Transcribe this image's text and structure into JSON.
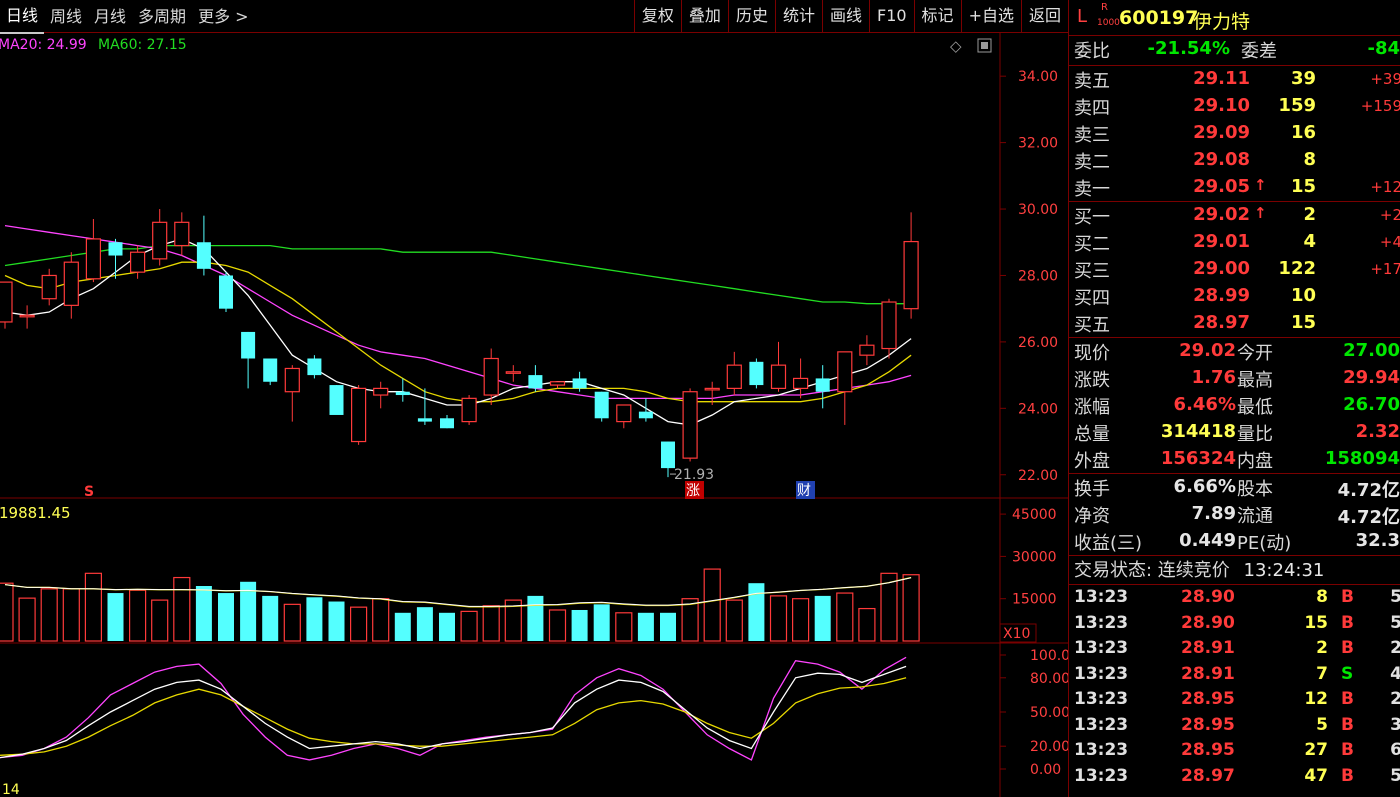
{
  "toolbar": {
    "periods": [
      "日线",
      "周线",
      "月线",
      "多周期",
      "更多 >"
    ],
    "buttons": [
      "复权",
      "叠加",
      "历史",
      "统计",
      "画线",
      "F10",
      "标记",
      "+自选",
      "返回"
    ]
  },
  "ma_legend": {
    "ma20": "MA20: 24.99",
    "ma60": "MA60: 27.15"
  },
  "colors": {
    "up": "#ff3a3a",
    "down": "#54ffff",
    "ma5": "#ffffff",
    "ma10": "#e6d800",
    "ma20": "#ff44ff",
    "ma60": "#22dd22",
    "grid": "#7a0000",
    "axis_text": "#ff4040"
  },
  "price_axis": {
    "ticks": [
      "34.00",
      "32.00",
      "30.00",
      "28.00",
      "26.00",
      "24.00",
      "22.00"
    ],
    "min": 21.3,
    "max": 35.3
  },
  "low_label": "21.93",
  "markers": {
    "s": "S",
    "zhang": "涨",
    "cai": "财"
  },
  "vol_axis": {
    "ticks": [
      "45000",
      "30000",
      "15000"
    ],
    "unit": "X10",
    "max": 50000,
    "label": "19881.45"
  },
  "kdj_axis": {
    "ticks": [
      "100.00",
      "80.00",
      "50.00",
      "20.00",
      "0.00"
    ],
    "label": "14"
  },
  "chart_data": {
    "type": "candlestick",
    "candles": [
      {
        "o": 26.6,
        "h": 27.5,
        "l": 26.4,
        "c": 27.8
      },
      {
        "o": 26.8,
        "h": 27.1,
        "l": 26.4,
        "c": 26.8
      },
      {
        "o": 27.3,
        "h": 28.2,
        "l": 27.1,
        "c": 28.0
      },
      {
        "o": 27.1,
        "h": 28.7,
        "l": 26.7,
        "c": 28.4
      },
      {
        "o": 27.9,
        "h": 29.7,
        "l": 27.8,
        "c": 29.1
      },
      {
        "o": 29.0,
        "h": 29.1,
        "l": 27.9,
        "c": 28.6
      },
      {
        "o": 28.1,
        "h": 28.9,
        "l": 27.9,
        "c": 28.7
      },
      {
        "o": 28.5,
        "h": 30.0,
        "l": 28.3,
        "c": 29.6
      },
      {
        "o": 28.9,
        "h": 29.9,
        "l": 28.6,
        "c": 29.6
      },
      {
        "o": 29.0,
        "h": 29.8,
        "l": 28.0,
        "c": 28.2
      },
      {
        "o": 28.0,
        "h": 28.1,
        "l": 26.9,
        "c": 27.0
      },
      {
        "o": 26.3,
        "h": 26.3,
        "l": 24.6,
        "c": 25.5
      },
      {
        "o": 25.5,
        "h": 25.5,
        "l": 24.7,
        "c": 24.8
      },
      {
        "o": 24.5,
        "h": 25.3,
        "l": 23.6,
        "c": 25.2
      },
      {
        "o": 25.5,
        "h": 25.6,
        "l": 24.9,
        "c": 25.0
      },
      {
        "o": 24.7,
        "h": 24.7,
        "l": 23.9,
        "c": 23.8
      },
      {
        "o": 23.0,
        "h": 24.7,
        "l": 22.9,
        "c": 24.6
      },
      {
        "o": 24.4,
        "h": 24.8,
        "l": 24.0,
        "c": 24.6
      },
      {
        "o": 24.5,
        "h": 24.9,
        "l": 24.2,
        "c": 24.4
      },
      {
        "o": 23.7,
        "h": 24.6,
        "l": 23.5,
        "c": 23.6
      },
      {
        "o": 23.7,
        "h": 23.8,
        "l": 23.4,
        "c": 23.4
      },
      {
        "o": 23.6,
        "h": 24.4,
        "l": 23.5,
        "c": 24.3
      },
      {
        "o": 24.4,
        "h": 25.8,
        "l": 24.1,
        "c": 25.5
      },
      {
        "o": 25.1,
        "h": 25.3,
        "l": 24.8,
        "c": 25.1
      },
      {
        "o": 25.0,
        "h": 25.3,
        "l": 24.5,
        "c": 24.6
      },
      {
        "o": 24.7,
        "h": 24.8,
        "l": 24.6,
        "c": 24.8
      },
      {
        "o": 24.9,
        "h": 25.1,
        "l": 24.5,
        "c": 24.6
      },
      {
        "o": 24.5,
        "h": 24.5,
        "l": 23.6,
        "c": 23.7
      },
      {
        "o": 23.6,
        "h": 24.1,
        "l": 23.4,
        "c": 24.1
      },
      {
        "o": 23.9,
        "h": 24.3,
        "l": 23.6,
        "c": 23.7
      },
      {
        "o": 23.0,
        "h": 23.0,
        "l": 21.93,
        "c": 22.2
      },
      {
        "o": 22.5,
        "h": 24.6,
        "l": 22.4,
        "c": 24.5
      },
      {
        "o": 24.6,
        "h": 24.8,
        "l": 24.1,
        "c": 24.6
      },
      {
        "o": 24.6,
        "h": 25.7,
        "l": 24.4,
        "c": 25.3
      },
      {
        "o": 25.4,
        "h": 25.5,
        "l": 24.6,
        "c": 24.7
      },
      {
        "o": 24.6,
        "h": 26.0,
        "l": 24.5,
        "c": 25.3
      },
      {
        "o": 24.6,
        "h": 25.5,
        "l": 24.3,
        "c": 24.9
      },
      {
        "o": 24.9,
        "h": 25.3,
        "l": 24.0,
        "c": 24.5
      },
      {
        "o": 24.5,
        "h": 25.7,
        "l": 23.5,
        "c": 25.7
      },
      {
        "o": 25.6,
        "h": 26.2,
        "l": 25.3,
        "c": 25.9
      },
      {
        "o": 25.8,
        "h": 27.3,
        "l": 25.5,
        "c": 27.2
      },
      {
        "o": 27.0,
        "h": 29.9,
        "l": 26.7,
        "c": 29.02
      }
    ],
    "ma5": [
      26.9,
      26.8,
      26.9,
      27.3,
      27.6,
      28.1,
      28.6,
      28.9,
      29.1,
      28.8,
      28.1,
      27.4,
      26.5,
      25.6,
      25.2,
      24.8,
      24.6,
      24.5,
      24.5,
      24.3,
      24.1,
      24.1,
      24.3,
      24.6,
      24.7,
      24.8,
      24.8,
      24.6,
      24.4,
      24.0,
      23.6,
      23.5,
      23.8,
      24.2,
      24.3,
      24.4,
      24.6,
      24.8,
      25.0,
      25.2,
      25.6,
      26.1
    ],
    "ma10": [
      28.0,
      27.7,
      27.6,
      27.8,
      27.9,
      28.0,
      28.1,
      28.2,
      28.4,
      28.4,
      28.3,
      28.1,
      27.7,
      27.3,
      26.8,
      26.3,
      25.8,
      25.3,
      24.9,
      24.5,
      24.3,
      24.2,
      24.2,
      24.3,
      24.5,
      24.6,
      24.6,
      24.6,
      24.6,
      24.5,
      24.3,
      24.2,
      24.2,
      24.2,
      24.2,
      24.2,
      24.2,
      24.3,
      24.5,
      24.7,
      25.1,
      25.6
    ],
    "ma20": [
      29.5,
      29.4,
      29.3,
      29.2,
      29.1,
      29.0,
      28.9,
      28.8,
      28.6,
      28.3,
      28.0,
      27.6,
      27.2,
      26.8,
      26.5,
      26.2,
      25.9,
      25.7,
      25.6,
      25.5,
      25.3,
      25.1,
      24.9,
      24.7,
      24.6,
      24.5,
      24.4,
      24.3,
      24.3,
      24.3,
      24.3,
      24.3,
      24.3,
      24.4,
      24.4,
      24.4,
      24.4,
      24.5,
      24.6,
      24.7,
      24.8,
      24.99
    ],
    "ma60": [
      28.3,
      28.4,
      28.5,
      28.6,
      28.7,
      28.8,
      28.8,
      28.9,
      28.9,
      28.9,
      28.9,
      28.9,
      28.9,
      28.8,
      28.8,
      28.8,
      28.8,
      28.8,
      28.7,
      28.7,
      28.7,
      28.7,
      28.7,
      28.6,
      28.5,
      28.4,
      28.3,
      28.2,
      28.1,
      28.0,
      27.9,
      27.8,
      27.7,
      27.6,
      27.5,
      27.4,
      27.3,
      27.2,
      27.2,
      27.15,
      27.15,
      27.15
    ],
    "volume": [
      20500,
      15200,
      18500,
      18500,
      24000,
      17000,
      18000,
      14500,
      22500,
      19500,
      17000,
      21000,
      16000,
      13000,
      15500,
      14000,
      12000,
      15000,
      10000,
      12000,
      10000,
      10500,
      12500,
      14500,
      16000,
      11000,
      11000,
      13000,
      10000,
      10000,
      10000,
      15000,
      25500,
      14500,
      20500,
      16000,
      15000,
      16000,
      17000,
      11500,
      24000,
      23500
    ],
    "volume_ma": [
      20000,
      19000,
      19000,
      18500,
      18500,
      18200,
      18300,
      18200,
      18200,
      18100,
      17800,
      17900,
      17500,
      16800,
      16300,
      15900,
      15200,
      14900,
      13900,
      13700,
      12900,
      12100,
      12100,
      12300,
      12700,
      12800,
      13400,
      13600,
      13000,
      12600,
      12600,
      13000,
      14200,
      15400,
      16800,
      17300,
      17900,
      18300,
      18900,
      19400,
      20700,
      22500
    ],
    "kdj_k": [
      10,
      12,
      18,
      28,
      45,
      65,
      75,
      85,
      90,
      92,
      75,
      48,
      28,
      12,
      8,
      12,
      18,
      22,
      18,
      12,
      22,
      25,
      28,
      30,
      32,
      35,
      65,
      80,
      88,
      82,
      70,
      50,
      30,
      18,
      8,
      62,
      95,
      92,
      85,
      70,
      87,
      98
    ],
    "kdj_d": [
      12,
      13,
      15,
      20,
      28,
      38,
      47,
      58,
      65,
      70,
      65,
      55,
      45,
      35,
      27,
      24,
      22,
      22,
      21,
      20,
      20,
      22,
      24,
      26,
      28,
      30,
      40,
      52,
      58,
      60,
      57,
      50,
      40,
      32,
      27,
      40,
      58,
      66,
      71,
      72,
      75,
      80
    ],
    "kdj_j": [
      10,
      13,
      18,
      25,
      38,
      50,
      60,
      70,
      76,
      78,
      70,
      55,
      40,
      28,
      18,
      20,
      22,
      24,
      22,
      18,
      22,
      24,
      27,
      30,
      32,
      36,
      58,
      70,
      78,
      76,
      68,
      52,
      36,
      25,
      18,
      50,
      80,
      84,
      83,
      76,
      83,
      90
    ]
  },
  "panel": {
    "code": "600197",
    "name": "伊力特",
    "l_badge": "L",
    "r_badge": "R",
    "r_sub": "1000",
    "weibi": {
      "label": "委比",
      "value": "-21.54%",
      "label2": "委差",
      "value2": "-84"
    },
    "asks": [
      {
        "label": "卖五",
        "price": "29.11",
        "vol": "39",
        "chg": "+39",
        "arrow": ""
      },
      {
        "label": "卖四",
        "price": "29.10",
        "vol": "159",
        "chg": "+159",
        "arrow": ""
      },
      {
        "label": "卖三",
        "price": "29.09",
        "vol": "16",
        "chg": "",
        "arrow": ""
      },
      {
        "label": "卖二",
        "price": "29.08",
        "vol": "8",
        "chg": "",
        "arrow": ""
      },
      {
        "label": "卖一",
        "price": "29.05",
        "vol": "15",
        "chg": "+12",
        "arrow": "↑"
      }
    ],
    "bids": [
      {
        "label": "买一",
        "price": "29.02",
        "vol": "2",
        "chg": "+2",
        "arrow": "↑"
      },
      {
        "label": "买二",
        "price": "29.01",
        "vol": "4",
        "chg": "+4",
        "arrow": ""
      },
      {
        "label": "买三",
        "price": "29.00",
        "vol": "122",
        "chg": "+17",
        "arrow": ""
      },
      {
        "label": "买四",
        "price": "28.99",
        "vol": "10",
        "chg": "",
        "arrow": ""
      },
      {
        "label": "买五",
        "price": "28.97",
        "vol": "15",
        "chg": "",
        "arrow": ""
      }
    ],
    "stats": [
      {
        "l1": "现价",
        "v1": "29.02",
        "c1": "red",
        "l2": "今开",
        "v2": "27.00",
        "c2": "green"
      },
      {
        "l1": "涨跌",
        "v1": "1.76",
        "c1": "red",
        "l2": "最高",
        "v2": "29.94",
        "c2": "red"
      },
      {
        "l1": "涨幅",
        "v1": "6.46%",
        "c1": "red",
        "l2": "最低",
        "v2": "26.70",
        "c2": "green"
      },
      {
        "l1": "总量",
        "v1": "314418",
        "c1": "yellow",
        "l2": "量比",
        "v2": "2.32",
        "c2": "red"
      },
      {
        "l1": "外盘",
        "v1": "156324",
        "c1": "red",
        "l2": "内盘",
        "v2": "158094",
        "c2": "green"
      }
    ],
    "stats2": [
      {
        "l1": "换手",
        "v1": "6.66%",
        "c1": "white",
        "l2": "股本",
        "v2": "4.72亿",
        "c2": "white"
      },
      {
        "l1": "净资",
        "v1": "7.89",
        "c1": "white",
        "l2": "流通",
        "v2": "4.72亿",
        "c2": "white"
      },
      {
        "l1": "收益(三)",
        "v1": "0.449",
        "c1": "white",
        "l2": "PE(动)",
        "v2": "32.3",
        "c2": "white"
      }
    ],
    "status": {
      "label": "交易状态: 连续竞价",
      "time": "13:24:31"
    },
    "ticks": [
      {
        "time": "13:23",
        "price": "28.90",
        "vol": "8",
        "side": "B",
        "extra": "5"
      },
      {
        "time": "13:23",
        "price": "28.90",
        "vol": "15",
        "side": "B",
        "extra": "5"
      },
      {
        "time": "13:23",
        "price": "28.91",
        "vol": "2",
        "side": "B",
        "extra": "2"
      },
      {
        "time": "13:23",
        "price": "28.91",
        "vol": "7",
        "side": "S",
        "extra": "4"
      },
      {
        "time": "13:23",
        "price": "28.95",
        "vol": "12",
        "side": "B",
        "extra": "2"
      },
      {
        "time": "13:23",
        "price": "28.95",
        "vol": "5",
        "side": "B",
        "extra": "3"
      },
      {
        "time": "13:23",
        "price": "28.95",
        "vol": "27",
        "side": "B",
        "extra": "6"
      },
      {
        "time": "13:23",
        "price": "28.97",
        "vol": "47",
        "side": "B",
        "extra": "5"
      }
    ]
  }
}
